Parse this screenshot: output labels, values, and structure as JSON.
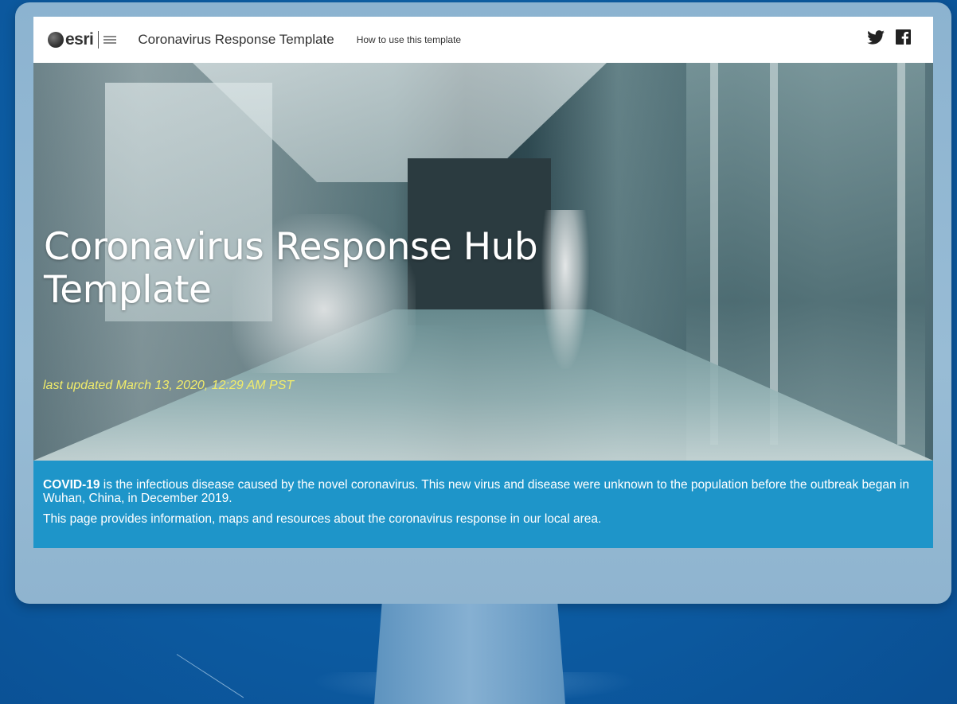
{
  "nav": {
    "logo_text": "esri",
    "site_title": "Coronavirus Response Template",
    "link": "How to use this template",
    "social": [
      {
        "icon": "twitter-icon"
      },
      {
        "icon": "facebook-icon"
      }
    ]
  },
  "hero": {
    "title": "Coronavirus Response Hub Template",
    "last_updated": "last updated March 13, 2020, 12:29 AM PST"
  },
  "intro": {
    "lead_bold": "COVID-19",
    "lead_rest": " is the infectious disease caused by the novel coronavirus. This new virus and disease were unknown to the population before the outbreak began in Wuhan, China, in December 2019.",
    "second": "This page provides information, maps and resources about the coronavirus response in our local area."
  },
  "colors": {
    "background": "#0d5fa6",
    "monitor_frame": "#8cb3d0",
    "intro_band": "#1e95c9",
    "updated_text": "#f1ec6a"
  }
}
